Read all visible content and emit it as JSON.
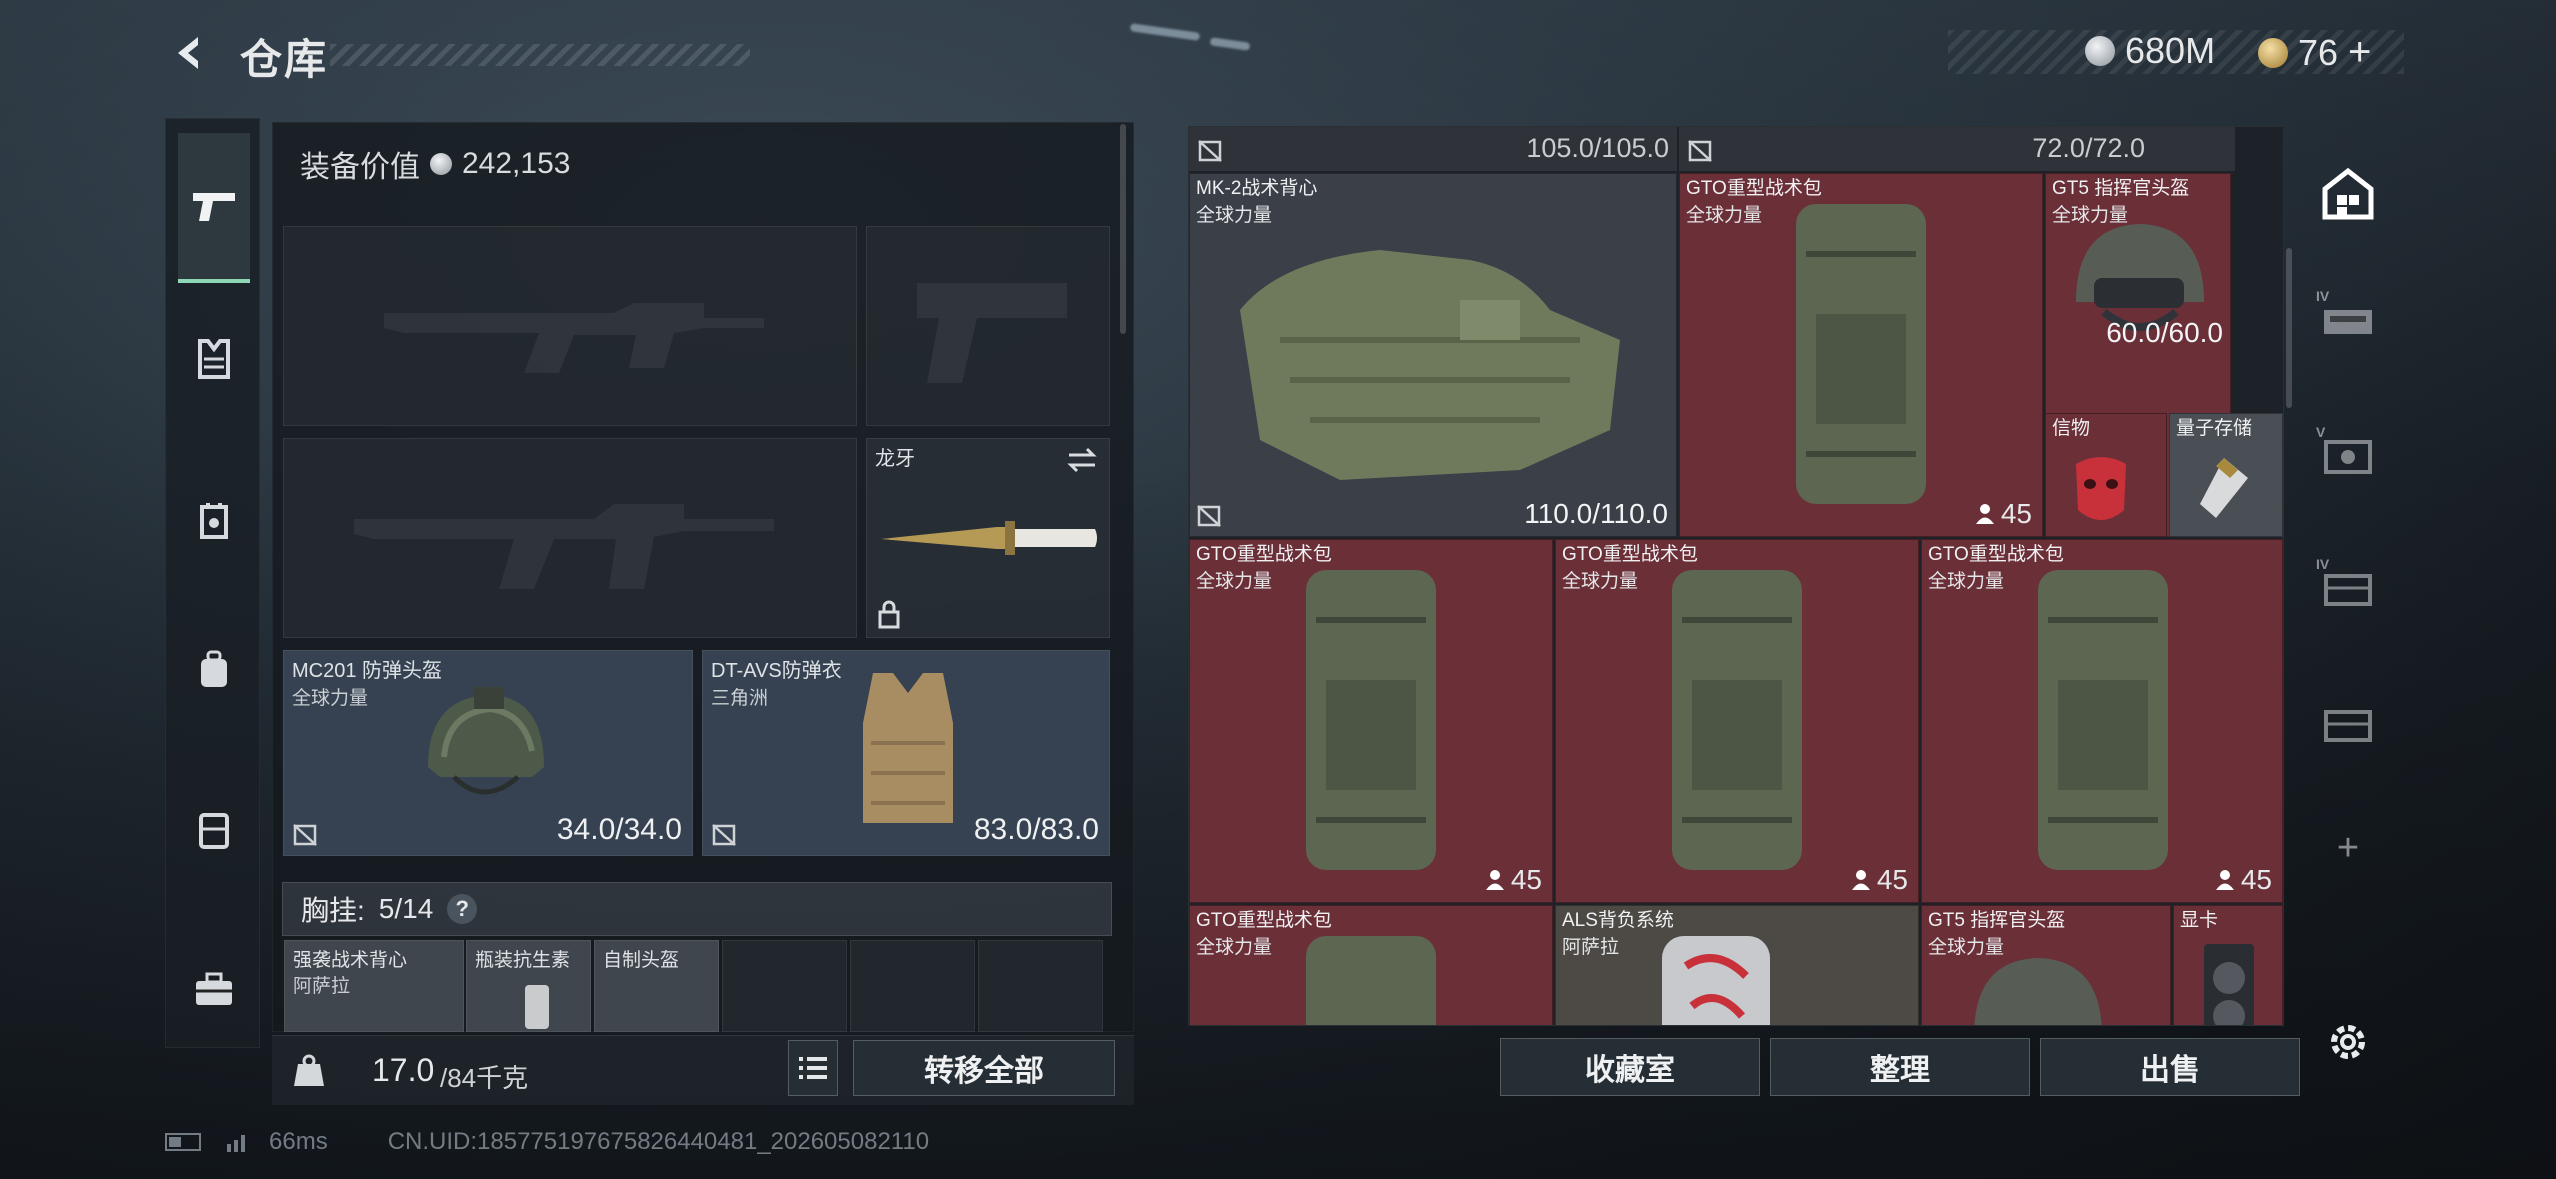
{
  "header": {
    "title": "仓库",
    "currency_main": "680M",
    "currency_secondary": "76",
    "currency_plus": "+"
  },
  "equipment": {
    "value_label": "装备价值",
    "value": "242,153",
    "melee_name": "龙牙",
    "helmet": {
      "name": "MC201 防弹头盔",
      "tag": "全球力量",
      "durability": "34.0/34.0"
    },
    "armor": {
      "name": "DT-AVS防弹衣",
      "tag": "三角洲",
      "durability": "83.0/83.0"
    },
    "chest_label": "胸挂:",
    "chest_count": "5/14",
    "chest_help": "?",
    "chest_items": [
      {
        "name": "强袭战术背心",
        "tag": "阿萨拉"
      },
      {
        "name": "瓶装抗生素"
      },
      {
        "name": "自制头盔"
      }
    ],
    "weight_value": "17.0",
    "weight_max": "/84千克",
    "transfer_all": "转移全部"
  },
  "stash": {
    "header_left": "105.0/105.0",
    "header_right": "72.0/72.0",
    "items": [
      {
        "name": "MK-2战术背心",
        "tag": "全球力量",
        "durability": "110.0/110.0"
      },
      {
        "name": "GTO重型战术包",
        "tag": "全球力量",
        "count": "45"
      },
      {
        "name": "GT5 指挥官头盔",
        "tag": "全球力量",
        "durability": "60.0/60.0"
      },
      {
        "name": "信物"
      },
      {
        "name": "量子存储"
      },
      {
        "name": "GTO重型战术包",
        "tag": "全球力量",
        "count": "45"
      },
      {
        "name": "GTO重型战术包",
        "tag": "全球力量",
        "count": "45"
      },
      {
        "name": "GTO重型战术包",
        "tag": "全球力量",
        "count": "45"
      },
      {
        "name": "GTO重型战术包",
        "tag": "全球力量"
      },
      {
        "name": "ALS背负系统",
        "tag": "阿萨拉"
      },
      {
        "name": "GT5 指挥官头盔",
        "tag": "全球力量"
      },
      {
        "name": "显卡"
      }
    ],
    "buttons": {
      "collection": "收藏室",
      "sort": "整理",
      "sell": "出售"
    }
  },
  "right_nav": {
    "tier_4a": "IV",
    "tier_5": "V",
    "tier_4b": "IV",
    "add": "+"
  },
  "status": {
    "ping": "66ms",
    "uid": "CN.UID:1857751976758264404​81_202605082110"
  },
  "colors": {
    "item_bg": "#6b2f38",
    "accent": "#8fd8b5"
  }
}
